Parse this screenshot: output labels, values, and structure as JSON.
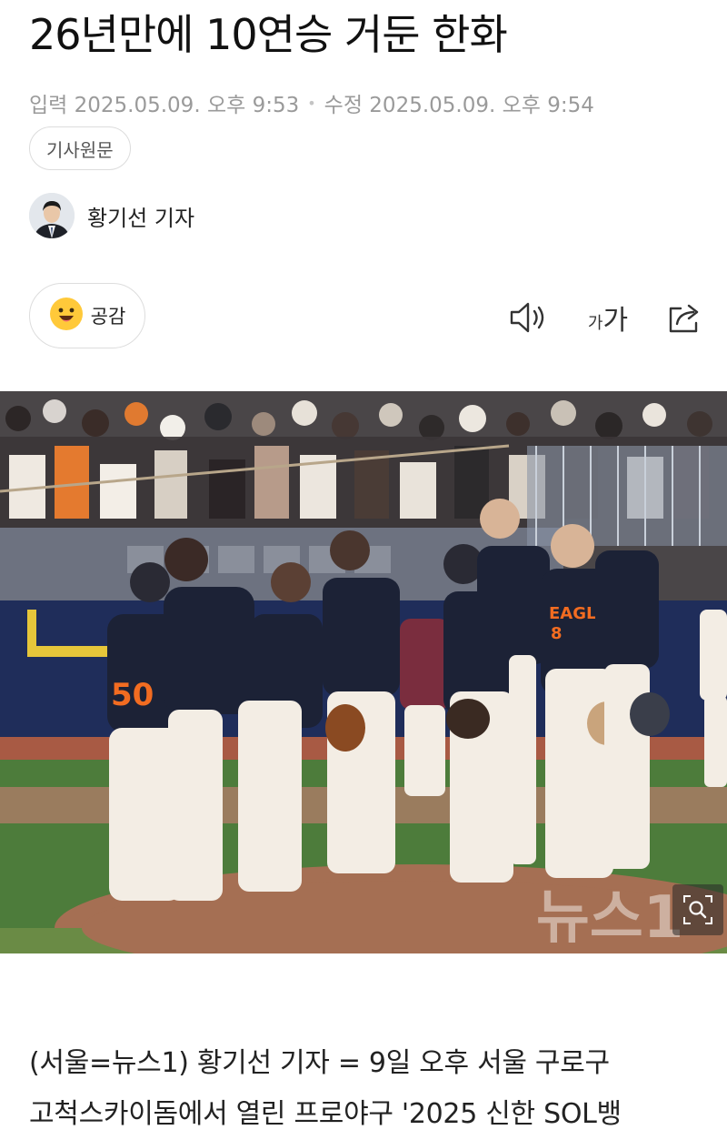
{
  "article": {
    "title": "26년만에 10연승 거둔 한화",
    "published": "입력 2025.05.09. 오후 9:53",
    "modified": "수정 2025.05.09. 오후 9:54",
    "source_button": "기사원문",
    "author": "황기선 기자",
    "body_lines": [
      "(서울=뉴스1) 황기선 기자 = 9일 오후 서울 구로구",
      "고척스카이돔에서 열린 프로야구 '2025 신한 SOL뱅"
    ]
  },
  "actions": {
    "empathy_label": "공감",
    "font_size_label_small": "가",
    "font_size_label_large": "가"
  },
  "photo": {
    "watermark": "뉴스1",
    "jersey_numbers": [
      "50",
      "8"
    ],
    "jersey_lettering": "EAGLES"
  },
  "icons": {
    "empathy": "smile-emoji-icon",
    "audio": "speaker-icon",
    "font_size": "font-size-icon",
    "share": "share-icon",
    "zoom": "zoom-icon"
  },
  "colors": {
    "meta_text": "#9a9a9a",
    "empathy_emoji": "#ffc93a",
    "jersey_navy": "#1c2236",
    "jersey_orange": "#f26c21",
    "field_green": "#4d7c3b"
  }
}
